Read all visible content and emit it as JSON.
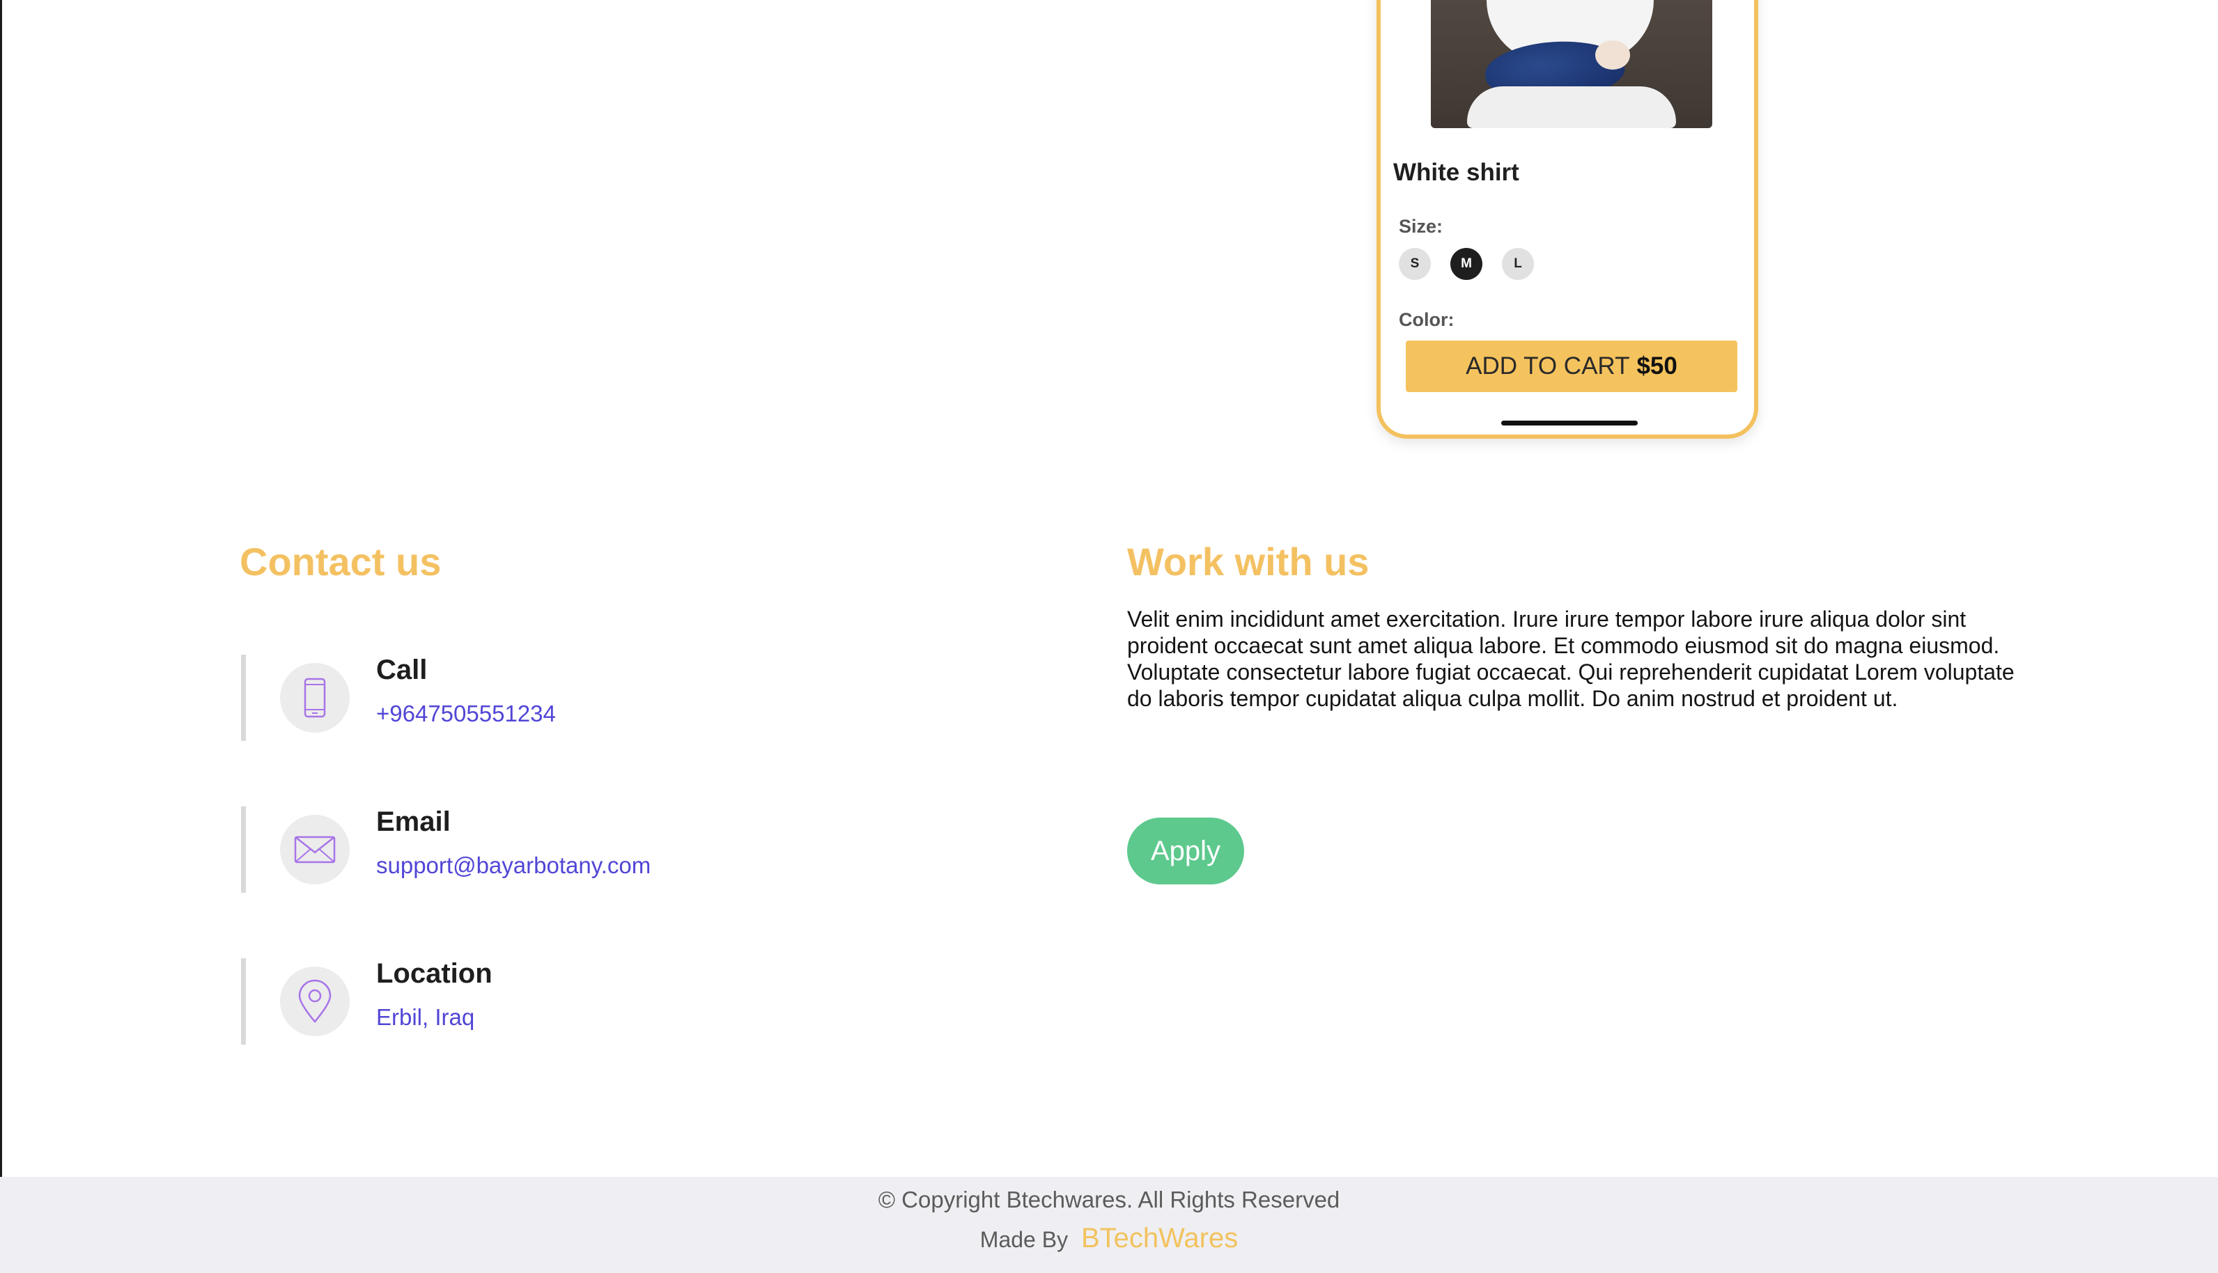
{
  "product": {
    "name": "White shirt",
    "size_label": "Size:",
    "sizes": [
      "S",
      "M",
      "L"
    ],
    "selected_size": "M",
    "color_label": "Color:",
    "cart_label": "ADD TO CART",
    "price": "$50"
  },
  "contact": {
    "title": "Contact us",
    "items": [
      {
        "label": "Call",
        "value": "+9647505551234",
        "icon": "phone-icon"
      },
      {
        "label": "Email",
        "value": "support@bayarbotany.com",
        "icon": "envelope-icon"
      },
      {
        "label": "Location",
        "value": "Erbil, Iraq",
        "icon": "map-pin-icon"
      }
    ]
  },
  "work": {
    "title": "Work with us",
    "text": "Velit enim incididunt amet exercitation. Irure irure tempor labore irure aliqua dolor sint proident occaecat sunt amet aliqua labore. Et commodo eiusmod sit do magna eiusmod. Voluptate consectetur labore fugiat occaecat. Qui reprehenderit cupidatat Lorem voluptate do laboris tempor cupidatat aliqua culpa mollit. Do anim nostrud et proident ut.",
    "apply_label": "Apply"
  },
  "footer": {
    "copyright": "© Copyright Btechwares. All Rights Reserved",
    "made_by_label": "Made By",
    "brand": "BTechWares"
  },
  "colors": {
    "accent_yellow": "#f4c162",
    "link_purple": "#5146d6",
    "apply_green": "#5dc98d",
    "footer_bg": "#efeff3"
  }
}
